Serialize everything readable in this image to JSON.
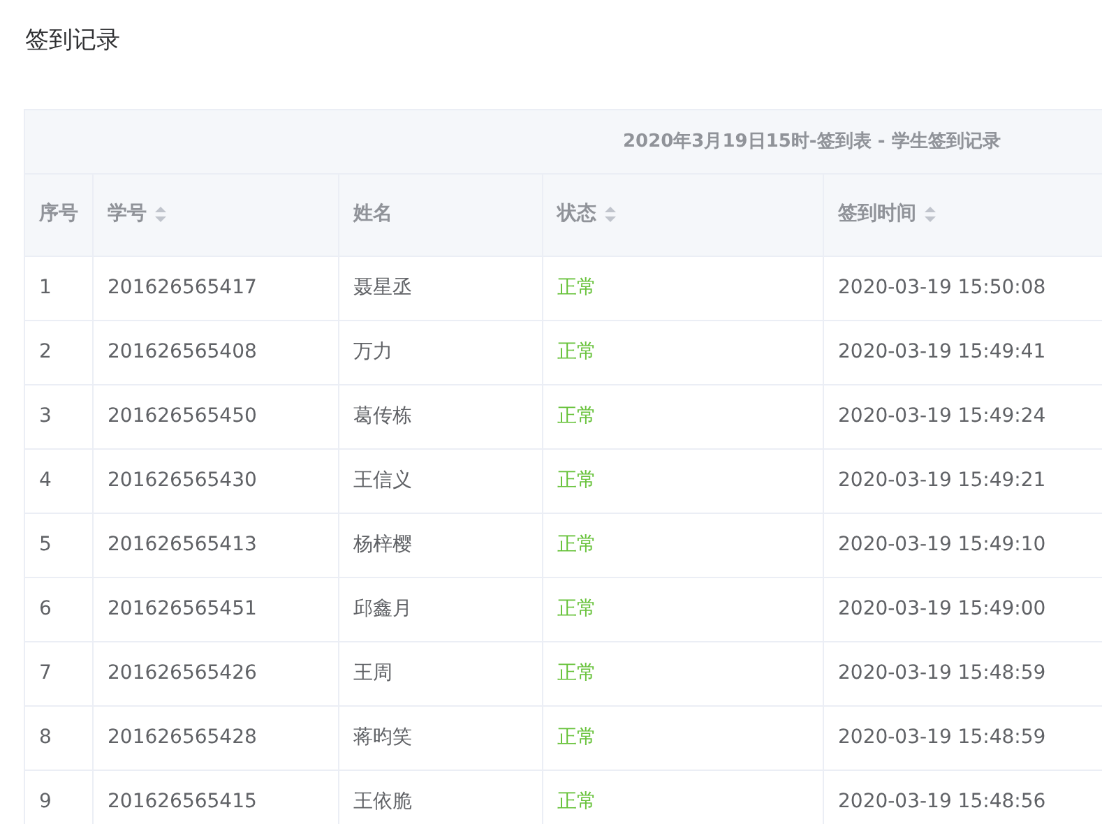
{
  "page_title": "签到记录",
  "table": {
    "caption": "2020年3月19日15时-签到表 - 学生签到记录",
    "columns": [
      {
        "label": "序号",
        "sortable": false
      },
      {
        "label": "学号",
        "sortable": true
      },
      {
        "label": "姓名",
        "sortable": false
      },
      {
        "label": "状态",
        "sortable": true
      },
      {
        "label": "签到时间",
        "sortable": true
      }
    ],
    "rows": [
      {
        "index": "1",
        "student_id": "201626565417",
        "name": "聂星丞",
        "status": "正常",
        "kind": "normal",
        "time": "2020-03-19 15:50:08"
      },
      {
        "index": "2",
        "student_id": "201626565408",
        "name": "万力",
        "status": "正常",
        "kind": "normal",
        "time": "2020-03-19 15:49:41"
      },
      {
        "index": "3",
        "student_id": "201626565450",
        "name": "葛传栋",
        "status": "正常",
        "kind": "normal",
        "time": "2020-03-19 15:49:24"
      },
      {
        "index": "4",
        "student_id": "201626565430",
        "name": "王信义",
        "status": "正常",
        "kind": "normal",
        "time": "2020-03-19 15:49:21"
      },
      {
        "index": "5",
        "student_id": "201626565413",
        "name": "杨梓樱",
        "status": "正常",
        "kind": "normal",
        "time": "2020-03-19 15:49:10"
      },
      {
        "index": "6",
        "student_id": "201626565451",
        "name": "邱鑫月",
        "status": "正常",
        "kind": "normal",
        "time": "2020-03-19 15:49:00"
      },
      {
        "index": "7",
        "student_id": "201626565426",
        "name": "王周",
        "status": "正常",
        "kind": "normal",
        "time": "2020-03-19 15:48:59"
      },
      {
        "index": "8",
        "student_id": "201626565428",
        "name": "蒋昀笑",
        "status": "正常",
        "kind": "normal",
        "time": "2020-03-19 15:48:59"
      },
      {
        "index": "9",
        "student_id": "201626565415",
        "name": "王依脆",
        "status": "正常",
        "kind": "normal",
        "time": "2020-03-19 15:48:56"
      }
    ]
  }
}
